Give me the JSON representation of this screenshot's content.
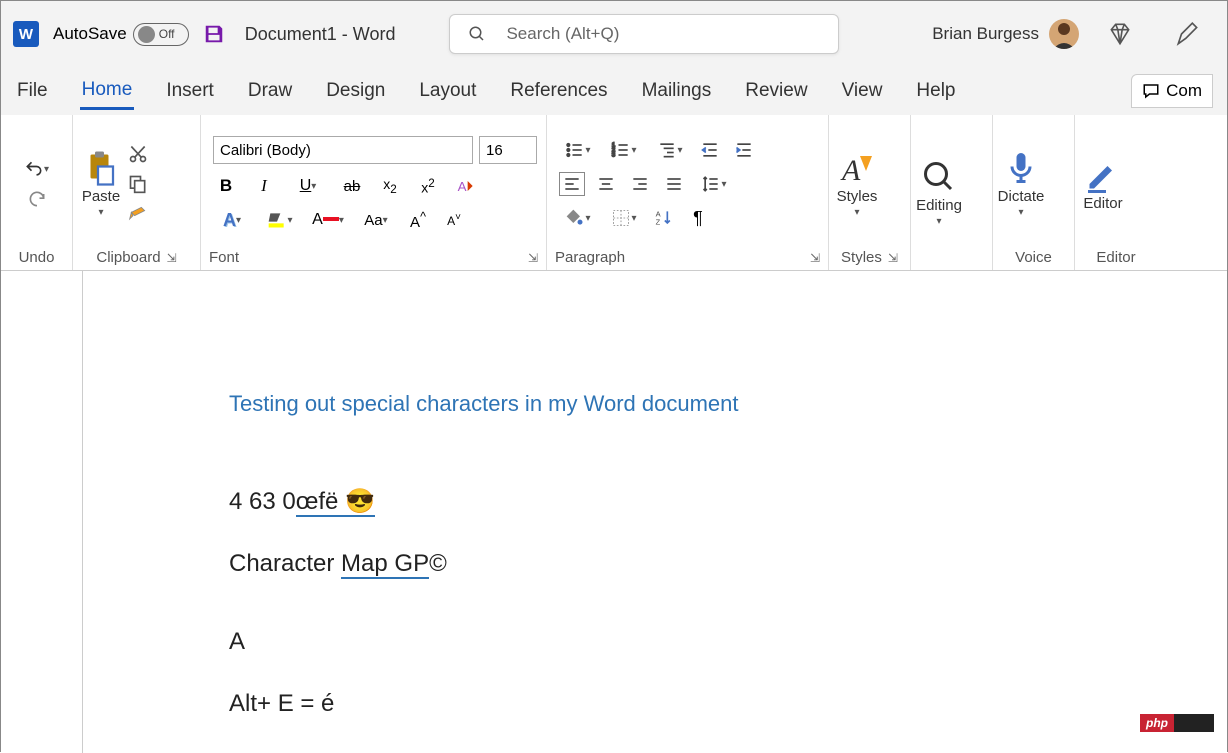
{
  "title": {
    "autosave": "AutoSave",
    "autosave_state": "Off",
    "doc": "Document1  -  Word",
    "search_placeholder": "Search (Alt+Q)",
    "user": "Brian Burgess"
  },
  "tabs": [
    "File",
    "Home",
    "Insert",
    "Draw",
    "Design",
    "Layout",
    "References",
    "Mailings",
    "Review",
    "View",
    "Help"
  ],
  "active_tab": "Home",
  "comments_label": "Com",
  "ribbon": {
    "undo": "Undo",
    "clipboard": "Clipboard",
    "paste": "Paste",
    "font_group": "Font",
    "font_name": "Calibri (Body)",
    "font_size": "16",
    "paragraph": "Paragraph",
    "styles": "Styles",
    "styles_btn": "Styles",
    "editing": "Editing",
    "voice": "Voice",
    "dictate": "Dictate",
    "editor": "Editor",
    "editor_btn": "Editor"
  },
  "document": {
    "heading": "Testing out special characters in my Word document",
    "line1_a": "4 63   0",
    "line1_b": "œfë",
    "line1_c": "  😎 ",
    "line2_a": "Character ",
    "line2_b": "Map  GP",
    "line2_c": "©",
    "line3": "A",
    "line4": "Alt+ E = é"
  },
  "badge": "php"
}
